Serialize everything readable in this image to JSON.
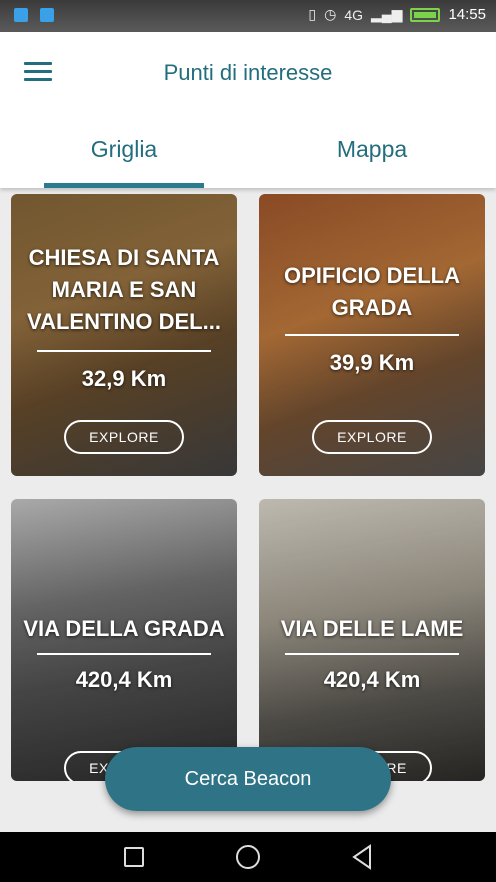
{
  "status_bar": {
    "time": "14:55",
    "network": "4G"
  },
  "app_bar": {
    "title": "Punti di interesse"
  },
  "tabs": [
    {
      "label": "Griglia",
      "active": true
    },
    {
      "label": "Mappa",
      "active": false
    }
  ],
  "cards": [
    {
      "title": "CHIESA DI SANTA MARIA E SAN VALENTINO DEL...",
      "distance": "32,9 Km",
      "button": "EXPLORE"
    },
    {
      "title": "OPIFICIO DELLA GRADA",
      "distance": "39,9 Km",
      "button": "EXPLORE"
    },
    {
      "title": "VIA DELLA GRADA",
      "distance": "420,4 Km",
      "button": "EXPLORE"
    },
    {
      "title": "VIA DELLE LAME",
      "distance": "420,4 Km",
      "button": "EXPLORE"
    }
  ],
  "fab": {
    "label": "Cerca Beacon"
  },
  "colors": {
    "accent": "#2e7486",
    "title_text": "#236e7e"
  }
}
